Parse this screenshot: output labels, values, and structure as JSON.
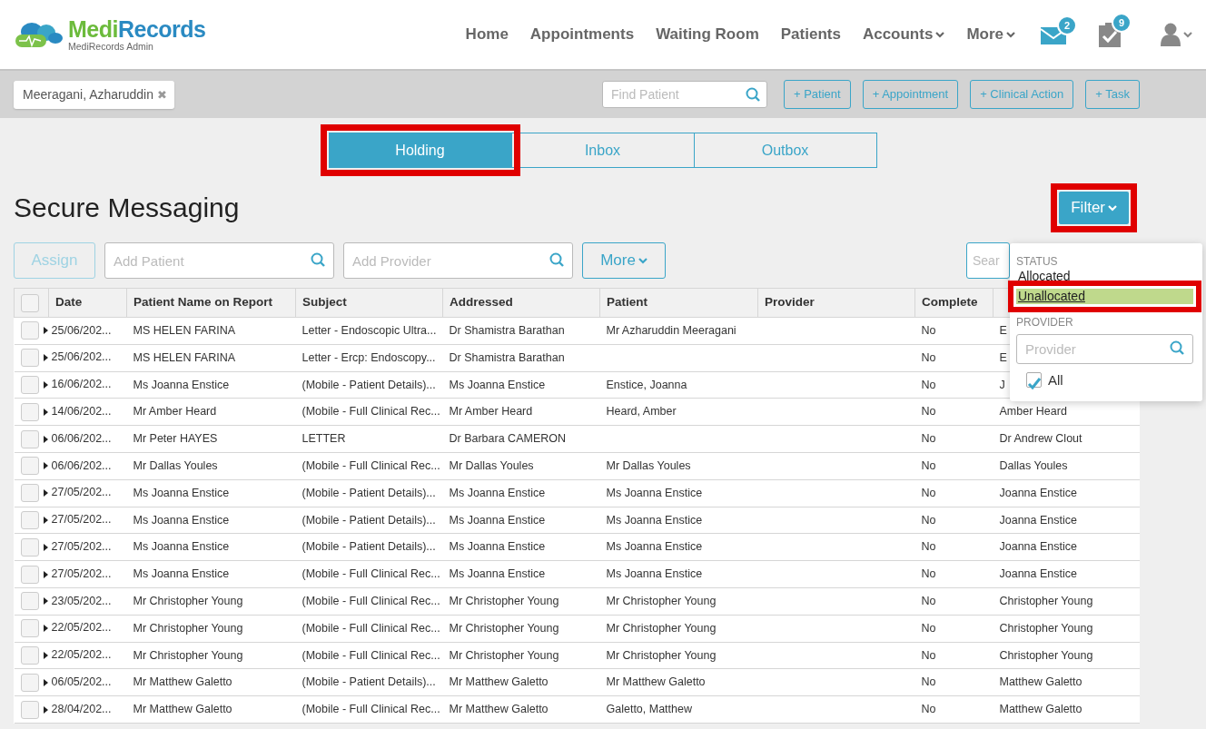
{
  "header": {
    "logo_title_first": "Medi",
    "logo_title_second": "Records",
    "logo_subtitle": "MediRecords Admin",
    "nav": [
      {
        "label": "Home",
        "dropdown": false
      },
      {
        "label": "Appointments",
        "dropdown": false
      },
      {
        "label": "Waiting Room",
        "dropdown": false
      },
      {
        "label": "Patients",
        "dropdown": false
      },
      {
        "label": "Accounts",
        "dropdown": true
      },
      {
        "label": "More",
        "dropdown": true
      }
    ],
    "messages_badge": "2",
    "tasks_badge": "9"
  },
  "toolbar": {
    "patient_tag": "Meeragani, Azharuddin",
    "close_glyph": "✖",
    "find_placeholder": "Find Patient",
    "buttons": [
      "+ Patient",
      "+ Appointment",
      "+ Clinical Action",
      "+ Task"
    ]
  },
  "tabs": [
    {
      "label": "Holding",
      "selected": true,
      "highlighted": true
    },
    {
      "label": "Inbox",
      "selected": false,
      "highlighted": false
    },
    {
      "label": "Outbox",
      "selected": false,
      "highlighted": false
    }
  ],
  "title": "Secure Messaging",
  "filter_button": {
    "label": "Filter",
    "highlighted": true
  },
  "actions": {
    "assign": {
      "label": "Assign",
      "disabled": true
    },
    "patient_placeholder": "Add Patient",
    "provider_placeholder": "Add Provider",
    "more": "More",
    "search_placeholder": "Sear"
  },
  "table": {
    "select_all_checked": false,
    "columns": [
      "Date",
      "Patient Name on Report",
      "Subject",
      "Addressed",
      "Patient",
      "Provider",
      "Complete"
    ],
    "rows": [
      {
        "checked": false,
        "date": "25/06/202...",
        "patient_name": "MS HELEN FARINA",
        "subject": "Letter - Endoscopic Ultra...",
        "addressed": "Dr Shamistra Barathan",
        "patient": "Mr Azharuddin Meeragani",
        "complete": "No",
        "column_9": "E"
      },
      {
        "checked": false,
        "date": "25/06/202...",
        "patient_name": "MS HELEN FARINA",
        "subject": "Letter - Ercp: Endoscopy...",
        "addressed": "Dr Shamistra Barathan",
        "complete": "No",
        "column_9": "E"
      },
      {
        "checked": false,
        "date": "16/06/202...",
        "patient_name": "Ms Joanna Enstice",
        "subject": "(Mobile - Patient Details)...",
        "addressed": "Ms Joanna Enstice",
        "patient": "Enstice, Joanna",
        "complete": "No",
        "column_9": "J"
      },
      {
        "checked": false,
        "date": "14/06/202...",
        "patient_name": "Mr Amber Heard",
        "subject": "(Mobile - Full Clinical Rec...",
        "addressed": "Mr Amber Heard",
        "patient": "Heard, Amber",
        "complete": "No",
        "column_9": "Amber Heard"
      },
      {
        "checked": false,
        "date": "06/06/202...",
        "patient_name": "Mr Peter HAYES",
        "subject": "LETTER",
        "addressed": "Dr Barbara CAMERON",
        "complete": "No",
        "column_9": "Dr Andrew Clout"
      },
      {
        "checked": false,
        "date": "06/06/202...",
        "patient_name": "Mr Dallas Youles",
        "subject": "(Mobile - Full Clinical Rec...",
        "addressed": "Mr Dallas Youles",
        "patient": "Mr Dallas Youles",
        "complete": "No",
        "column_9": "Dallas Youles"
      },
      {
        "checked": false,
        "date": "27/05/202...",
        "patient_name": "Ms Joanna Enstice",
        "subject": "(Mobile - Patient Details)...",
        "addressed": "Ms Joanna Enstice",
        "patient": "Ms Joanna Enstice",
        "complete": "No",
        "column_9": "Joanna Enstice"
      },
      {
        "checked": false,
        "date": "27/05/202...",
        "patient_name": "Ms Joanna Enstice",
        "subject": "(Mobile - Patient Details)...",
        "addressed": "Ms Joanna Enstice",
        "patient": "Ms Joanna Enstice",
        "complete": "No",
        "column_9": "Joanna Enstice"
      },
      {
        "checked": false,
        "date": "27/05/202...",
        "patient_name": "Ms Joanna Enstice",
        "subject": "(Mobile - Patient Details)...",
        "addressed": "Ms Joanna Enstice",
        "patient": "Ms Joanna Enstice",
        "complete": "No",
        "column_9": "Joanna Enstice"
      },
      {
        "checked": false,
        "date": "27/05/202...",
        "patient_name": "Ms Joanna Enstice",
        "subject": "(Mobile - Full Clinical Rec...",
        "addressed": "Ms Joanna Enstice",
        "patient": "Ms Joanna Enstice",
        "complete": "No",
        "column_9": "Joanna Enstice"
      },
      {
        "checked": false,
        "date": "23/05/202...",
        "patient_name": "Mr Christopher Young",
        "subject": "(Mobile - Full Clinical Rec...",
        "addressed": "Mr Christopher Young",
        "patient": "Mr Christopher Young",
        "complete": "No",
        "column_9": "Christopher Young"
      },
      {
        "checked": false,
        "date": "22/05/202...",
        "patient_name": "Mr Christopher Young",
        "subject": "(Mobile - Full Clinical Rec...",
        "addressed": "Mr Christopher Young",
        "patient": "Mr Christopher Young",
        "complete": "No",
        "column_9": "Christopher Young"
      },
      {
        "checked": false,
        "date": "22/05/202...",
        "patient_name": "Mr Christopher Young",
        "subject": "(Mobile - Full Clinical Rec...",
        "addressed": "Mr Christopher Young",
        "patient": "Mr Christopher Young",
        "complete": "No",
        "column_9": "Christopher Young"
      },
      {
        "checked": false,
        "date": "06/05/202...",
        "patient_name": "Mr Matthew Galetto",
        "subject": "(Mobile - Patient Details)...",
        "addressed": "Mr Matthew Galetto",
        "patient": "Mr Matthew Galetto",
        "complete": "No",
        "column_9": "Matthew Galetto"
      },
      {
        "checked": false,
        "date": "28/04/202...",
        "patient_name": "Mr Matthew Galetto",
        "subject": "(Mobile - Full Clinical Rec...",
        "addressed": "Mr Matthew Galetto",
        "patient": "Galetto, Matthew",
        "complete": "No",
        "column_9": "Matthew Galetto"
      }
    ]
  },
  "filter_menu": {
    "status_heading": "STATUS",
    "options": [
      {
        "label": "Allocated",
        "selected": false,
        "highlighted": false
      },
      {
        "label": "Unallocated",
        "selected": true,
        "highlighted": true
      }
    ],
    "provider_heading": "PROVIDER",
    "provider_placeholder": "Provider",
    "all": {
      "label": "All",
      "checked": true
    }
  }
}
